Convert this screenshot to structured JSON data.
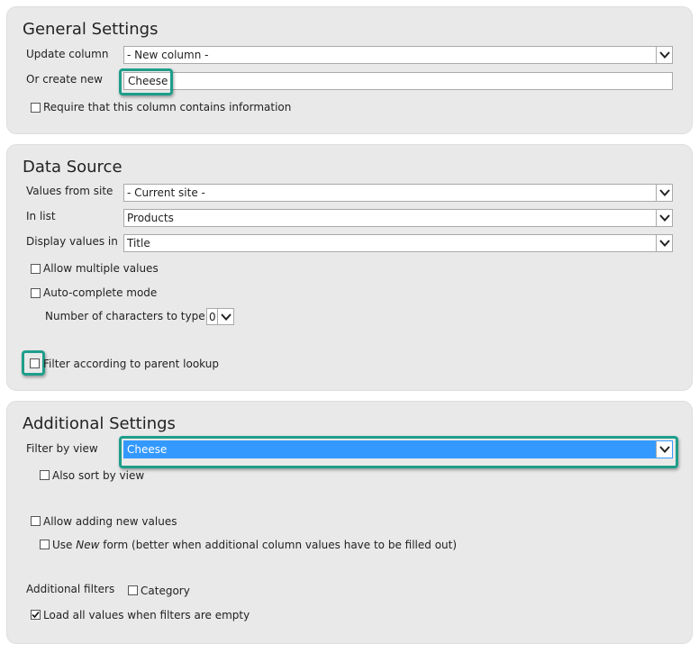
{
  "general": {
    "title": "General Settings",
    "update_column_label": "Update column",
    "update_column_value": "- New column -",
    "create_new_label": "Or create new",
    "create_new_value": "Cheese",
    "require_label": "Require that this column contains information",
    "require_checked": false
  },
  "data_source": {
    "title": "Data Source",
    "values_from_site_label": "Values from site",
    "values_from_site_value": "- Current site -",
    "in_list_label": "In list",
    "in_list_value": "Products",
    "display_values_label": "Display values in",
    "display_values_value": "Title",
    "allow_multiple_label": "Allow multiple values",
    "autocomplete_label": "Auto-complete mode",
    "num_chars_label": "Number of characters to type in",
    "num_chars_value": "0",
    "filter_parent_label": "Filter according to parent lookup"
  },
  "additional": {
    "title": "Additional Settings",
    "filter_by_view_label": "Filter by view",
    "filter_by_view_value": "Cheese",
    "also_sort_label": "Also sort by view",
    "allow_adding_label": "Allow adding new values",
    "use_new_form_pre": "Use ",
    "use_new_form_em": "New",
    "use_new_form_post": " form (better when additional column values have to be filled out)",
    "additional_filters_label": "Additional filters",
    "category_label": "Category",
    "load_all_label": "Load all values when filters are empty",
    "load_all_checked": true
  },
  "colors": {
    "highlight": "#1e9e8a",
    "selection": "#3399ff",
    "panel": "#e9e9e9"
  }
}
